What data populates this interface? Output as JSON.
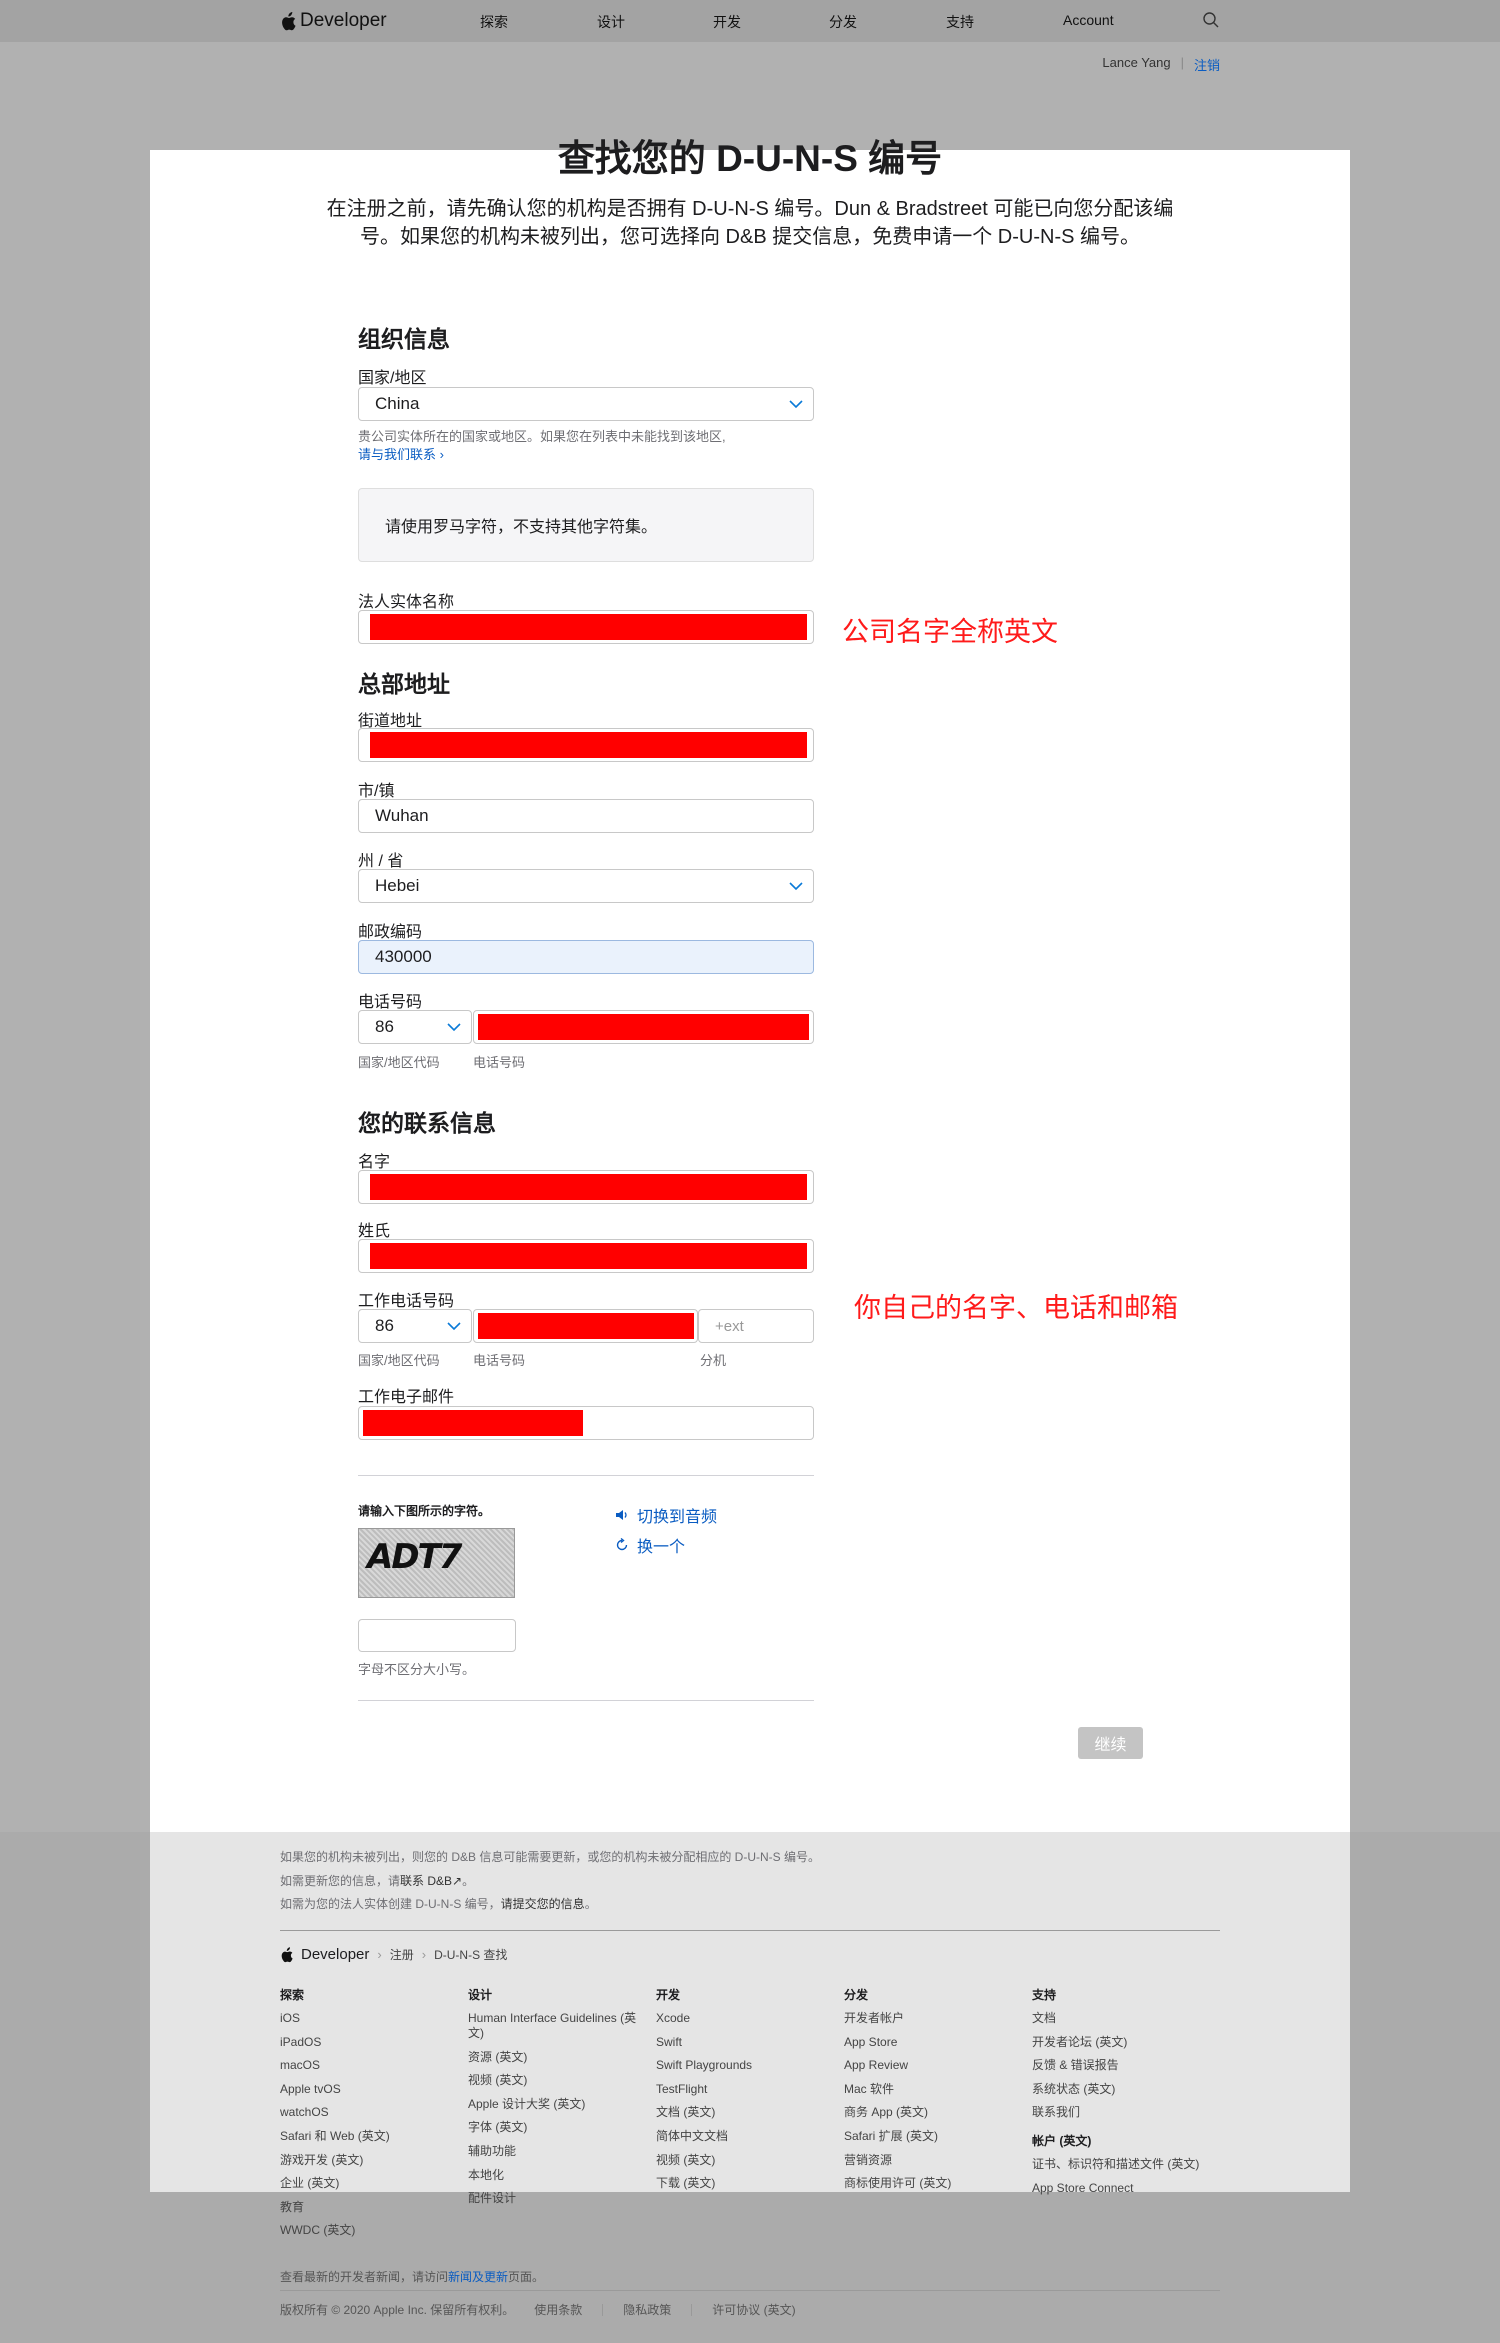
{
  "nav": {
    "brand": "Developer",
    "items": [
      "探索",
      "设计",
      "开发",
      "分发",
      "支持",
      "Account"
    ]
  },
  "userbar": {
    "user": "Lance Yang",
    "separator": "|",
    "logout": "注销"
  },
  "page": {
    "title": "查找您的 D-U-N-S 编号",
    "intro": "在注册之前，请先确认您的机构是否拥有 D-U-N-S 编号。Dun & Bradstreet 可能已向您分配该编号。如果您的机构未被列出，您可选择向 D&B 提交信息，免费申请一个 D-U-N-S 编号。"
  },
  "org": {
    "heading": "组织信息",
    "country_label": "国家/地区",
    "country_value": "China",
    "country_help": "贵公司实体所在的国家或地区。如果您在列表中未能找到该地区,",
    "contact_link": "请与我们联系 ›",
    "notice": "请使用罗马字符，不支持其他字符集。",
    "legal_name_label": "法人实体名称"
  },
  "hq": {
    "heading": "总部地址",
    "street_label": "街道地址",
    "city_label": "市/镇",
    "city_value": "Wuhan",
    "state_label": "州 / 省",
    "state_value": "Hebei",
    "postal_label": "邮政编码",
    "postal_value": "430000",
    "phone_label": "电话号码",
    "phone_code": "86",
    "sub_code": "国家/地区代码",
    "sub_phone": "电话号码"
  },
  "contact": {
    "heading": "您的联系信息",
    "first_label": "名字",
    "last_label": "姓氏",
    "work_phone_label": "工作电话号码",
    "phone_code": "86",
    "ext_placeholder": "+ext",
    "sub_code": "国家/地区代码",
    "sub_phone": "电话号码",
    "sub_ext": "分机",
    "email_label": "工作电子邮件"
  },
  "annotations": {
    "company": "公司名字全称英文",
    "personal": "你自己的名字、电话和邮箱"
  },
  "captcha": {
    "label": "请输入下图所示的字符。",
    "image_text": "ADT7",
    "audio": "切换到音频",
    "refresh": "换一个",
    "help": "字母不区分大小写。"
  },
  "continue_label": "继续",
  "footer": {
    "note1": "如果您的机构未被列出，则您的 D&B 信息可能需要更新，或您的机构未被分配相应的 D-U-N-S 编号。",
    "note2_prefix": "如需更新您的信息，请",
    "note2_link": "联系 D&B↗",
    "note2_suffix": "。",
    "note3_prefix": "如需为您的法人实体创建 D-U-N-S 编号，",
    "note3_link": "请提交您的信息",
    "note3_suffix": "。",
    "brand": "Developer",
    "crumbs": [
      "注册",
      "D-U-N-S 查找"
    ],
    "columns": [
      {
        "heading": "探索",
        "items": [
          "iOS",
          "iPadOS",
          "macOS",
          "Apple tvOS",
          "watchOS",
          "Safari 和 Web (英文)",
          "游戏开发 (英文)",
          "企业 (英文)",
          "教育",
          "WWDC (英文)"
        ]
      },
      {
        "heading": "设计",
        "items": [
          "Human Interface Guidelines (英文)",
          "资源 (英文)",
          "视频 (英文)",
          "Apple 设计大奖 (英文)",
          "字体 (英文)",
          "辅助功能",
          "本地化",
          "配件设计"
        ]
      },
      {
        "heading": "开发",
        "items": [
          "Xcode",
          "Swift",
          "Swift Playgrounds",
          "TestFlight",
          "文档 (英文)",
          "简体中文文档",
          "视频 (英文)",
          "下载 (英文)"
        ]
      },
      {
        "heading": "分发",
        "items": [
          "开发者帐户",
          "App Store",
          "App Review",
          "Mac 软件",
          "商务 App (英文)",
          "Safari 扩展 (英文)",
          "营销资源",
          "商标使用许可 (英文)"
        ]
      },
      {
        "heading": "支持",
        "items": [
          "文档",
          "开发者论坛 (英文)",
          "反馈 & 错误报告",
          "系统状态 (英文)",
          "联系我们"
        ],
        "heading2": "帐户 (英文)",
        "items2": [
          "证书、标识符和描述文件 (英文)",
          "App Store Connect"
        ]
      }
    ],
    "news_prefix": "查看最新的开发者新闻，请访问",
    "news_link": "新闻及更新",
    "news_suffix": "页面。",
    "copyright": "版权所有 © 2020 Apple Inc. 保留所有权利。",
    "legal_links": [
      "使用条款",
      "隐私政策",
      "许可协议 (英文)"
    ]
  },
  "colors": {
    "redaction": "#ff0000",
    "annotation": "#ff1a1a",
    "link": "#0a5cc2"
  }
}
